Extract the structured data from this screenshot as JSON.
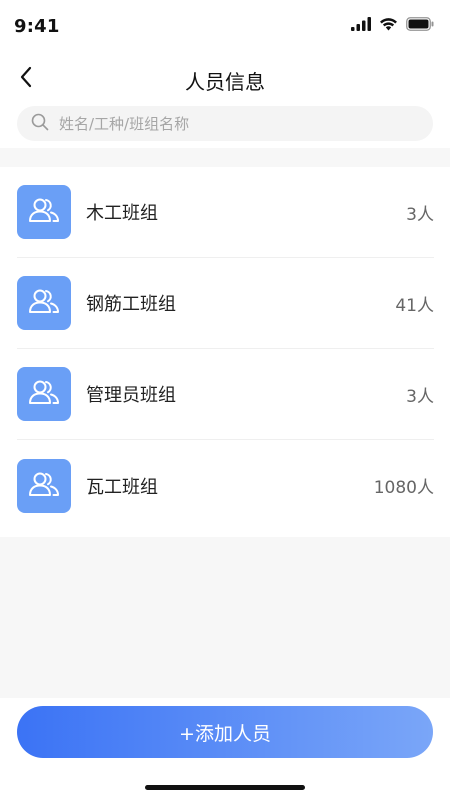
{
  "status_bar": {
    "time": "9:41",
    "icons": [
      "signal-icon",
      "wifi-icon",
      "battery-icon"
    ]
  },
  "header": {
    "back_icon": "chevron-left-icon",
    "title": "人员信息"
  },
  "search": {
    "icon": "search-icon",
    "placeholder": "姓名/工种/班组名称",
    "value": ""
  },
  "groups": [
    {
      "name": "木工班组",
      "count": "3人",
      "icon": "group-icon"
    },
    {
      "name": "钢筋工班组",
      "count": "41人",
      "icon": "group-icon"
    },
    {
      "name": "管理员班组",
      "count": "3人",
      "icon": "group-icon"
    },
    {
      "name": "瓦工班组",
      "count": "1080人",
      "icon": "group-icon"
    }
  ],
  "footer": {
    "add_button_label": "+添加人员"
  },
  "colors": {
    "accent": "#3b73f5",
    "accent_light": "#7aa6f8",
    "avatar_bg": "#6a9ff6",
    "page_bg": "#f7f7f7"
  }
}
